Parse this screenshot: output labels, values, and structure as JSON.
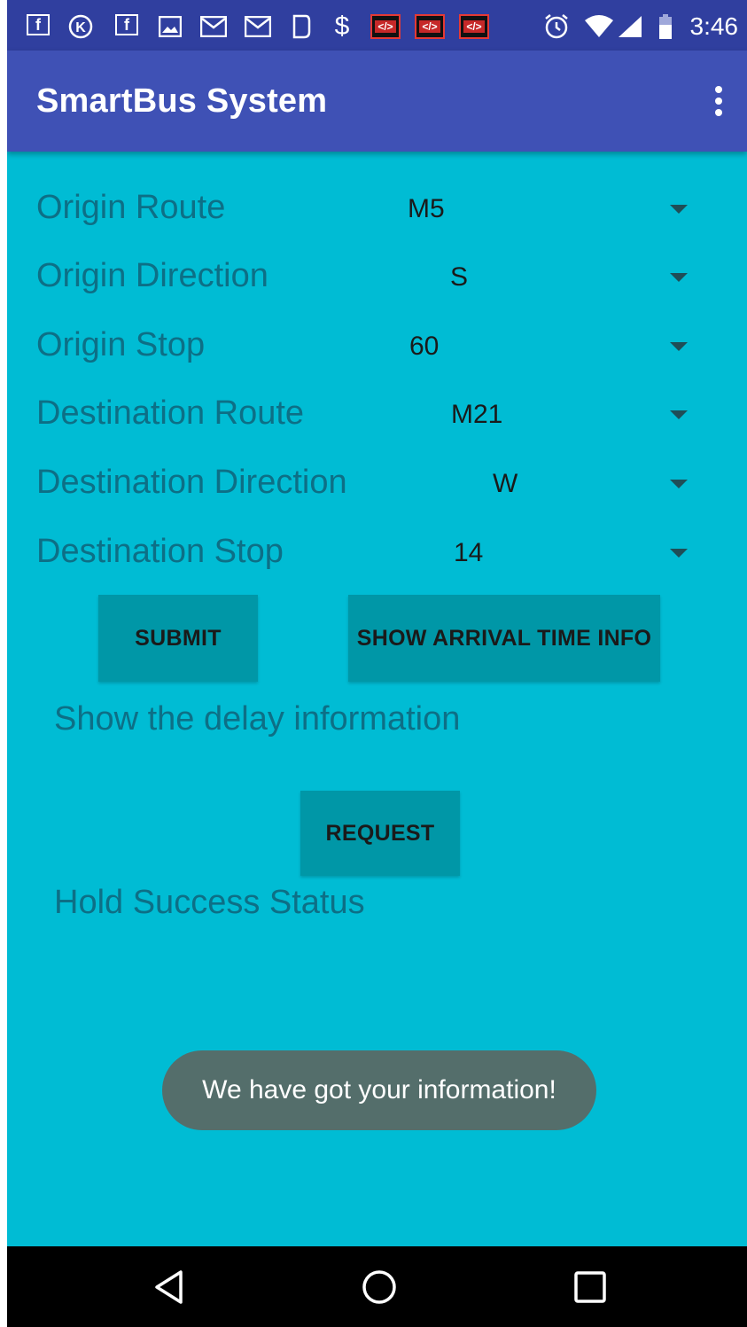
{
  "status_bar": {
    "time": "3:46",
    "left_icons": [
      "facebook-icon",
      "k-icon",
      "facebook-icon",
      "image-icon",
      "gmail-icon",
      "gmail-icon",
      "phone-icon",
      "dollar-icon",
      "dev-tools-icon",
      "dev-tools-icon",
      "dev-tools-icon"
    ],
    "dev_glyph": "</>",
    "dollar_glyph": "$",
    "k_glyph": "K",
    "f_glyph": "f",
    "right_icons": [
      "alarm-icon",
      "wifi-icon",
      "signal-icon",
      "battery-icon"
    ]
  },
  "app_bar": {
    "title": "SmartBus System"
  },
  "form": {
    "rows": [
      {
        "label": "Origin Route",
        "value": "M5"
      },
      {
        "label": "Origin Direction",
        "value": "S"
      },
      {
        "label": "Origin Stop",
        "value": "60"
      },
      {
        "label": "Destination Route",
        "value": "M21"
      },
      {
        "label": "Destination Direction",
        "value": "W"
      },
      {
        "label": "Destination Stop",
        "value": "14"
      }
    ]
  },
  "buttons": {
    "submit": "SUBMIT",
    "show_arrival": "SHOW ARRIVAL TIME INFO",
    "request": "REQUEST"
  },
  "text": {
    "delay_info": "Show the delay information",
    "hold_status": "Hold Success Status"
  },
  "toast": {
    "message": "We have got your information!"
  },
  "colors": {
    "status_bar": "#303f9f",
    "app_bar": "#3f51b5",
    "background": "#00bcd4",
    "button": "#0097a7",
    "label_text": "#0d6f86",
    "toast": "#546e6b"
  }
}
